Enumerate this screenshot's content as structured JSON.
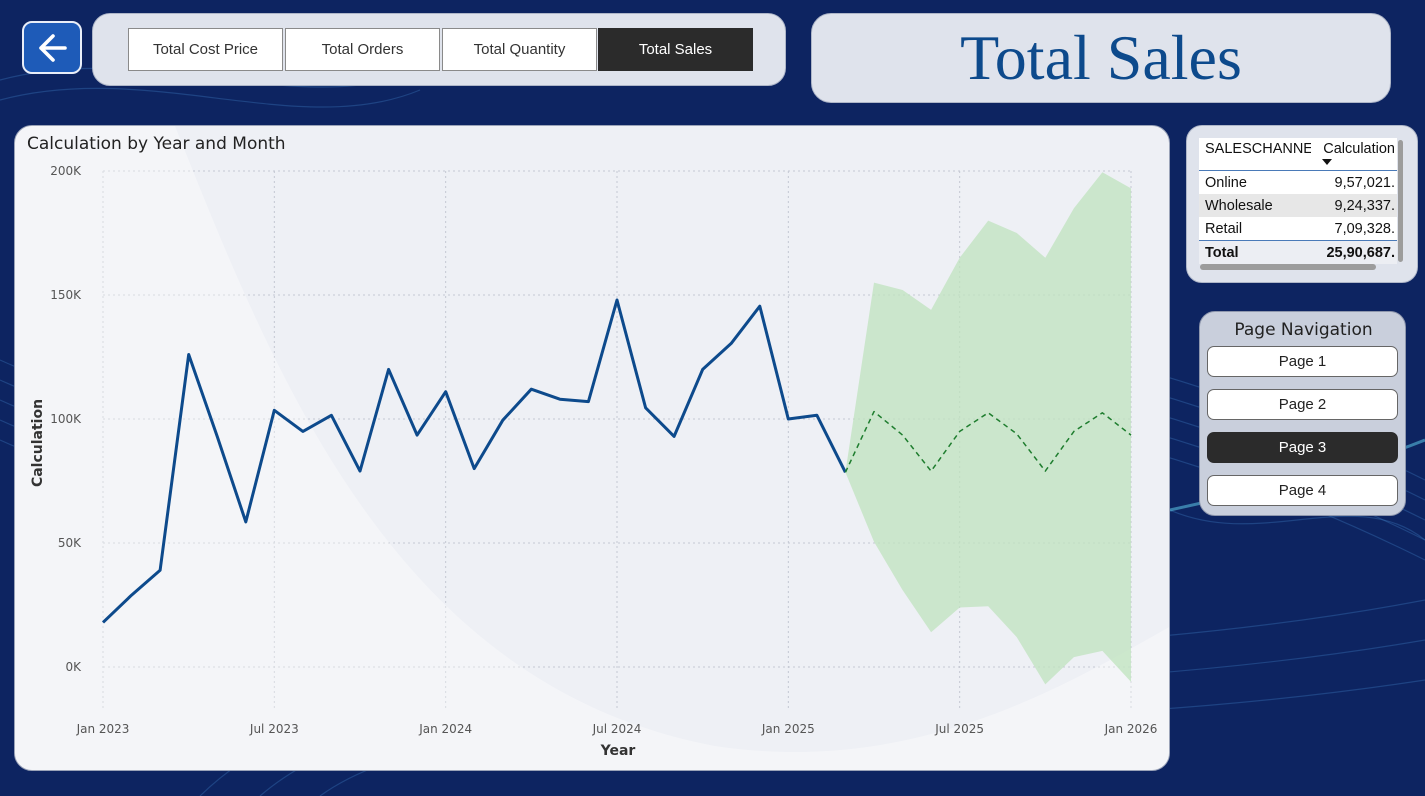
{
  "back_button": {
    "icon": "arrow-left-icon"
  },
  "tabs": [
    {
      "label": "Total Cost Price",
      "active": false
    },
    {
      "label": "Total Orders",
      "active": false
    },
    {
      "label": "Total Quantity",
      "active": false
    },
    {
      "label": "Total Sales",
      "active": true
    }
  ],
  "page_title": "Total Sales",
  "chart": {
    "title": "Calculation by Year and Month"
  },
  "chart_data": {
    "type": "line",
    "title": "Calculation by Year and Month",
    "xlabel": "Year",
    "ylabel": "Calculation",
    "ylim": [
      0,
      200000
    ],
    "y_ticks": [
      "0K",
      "50K",
      "100K",
      "150K",
      "200K"
    ],
    "x_ticks": [
      "Jan 2023",
      "Jul 2023",
      "Jan 2024",
      "Jul 2024",
      "Jan 2025",
      "Jul 2025",
      "Jan 2026"
    ],
    "grid": true,
    "series": [
      {
        "x": [
          "2023-01",
          "2023-02",
          "2023-03",
          "2023-04",
          "2023-05",
          "2023-06",
          "2023-07",
          "2023-08",
          "2023-09",
          "2023-10",
          "2023-11",
          "2023-12",
          "2024-01",
          "2024-02",
          "2024-03",
          "2024-04",
          "2024-05",
          "2024-06",
          "2024-07",
          "2024-08",
          "2024-09",
          "2024-10",
          "2024-11",
          "2024-12",
          "2025-01",
          "2025-02",
          "2025-03"
        ],
        "values": [
          18000,
          29000,
          39000,
          126000,
          93000,
          58500,
          103500,
          95000,
          101500,
          79000,
          120000,
          93500,
          111000,
          80000,
          99500,
          112000,
          108000,
          107000,
          148000,
          104500,
          93000,
          120000,
          130500,
          145500,
          100000,
          101500,
          78500
        ],
        "color": "#0d4a8c"
      },
      {
        "x": [
          "2025-03",
          "2025-04",
          "2025-05",
          "2025-06",
          "2025-07",
          "2025-08",
          "2025-09",
          "2025-10",
          "2025-11",
          "2025-12",
          "2026-01"
        ],
        "values": [
          78500,
          103000,
          93500,
          79000,
          95000,
          102500,
          94000,
          79000,
          95000,
          102500,
          93500
        ],
        "upper": [
          78500,
          155000,
          152000,
          144000,
          165000,
          180000,
          175000,
          165000,
          185000,
          199500,
          193000
        ],
        "lower": [
          78500,
          50500,
          31000,
          14000,
          24000,
          24500,
          12000,
          -7000,
          4000,
          6500,
          -6000
        ],
        "color": "#1e7d2e",
        "band_color": "#bfe3bd",
        "style": "dashed"
      }
    ]
  },
  "sales_table": {
    "headers": [
      "SALESCHANNEL",
      "Calculation"
    ],
    "rows": [
      [
        "Online",
        "9,57,021."
      ],
      [
        "Wholesale",
        "9,24,337."
      ],
      [
        "Retail",
        "7,09,328."
      ]
    ],
    "total": [
      "Total",
      "25,90,687."
    ]
  },
  "navigation": {
    "title": "Page Navigation",
    "pages": [
      {
        "label": "Page 1",
        "active": false
      },
      {
        "label": "Page 2",
        "active": false
      },
      {
        "label": "Page 3",
        "active": true
      },
      {
        "label": "Page 4",
        "active": false
      }
    ]
  },
  "colors": {
    "background": "#0d2461",
    "accent": "#1e5bb8",
    "title_text": "#0d4a8c",
    "active_button": "#2b2b2b"
  }
}
